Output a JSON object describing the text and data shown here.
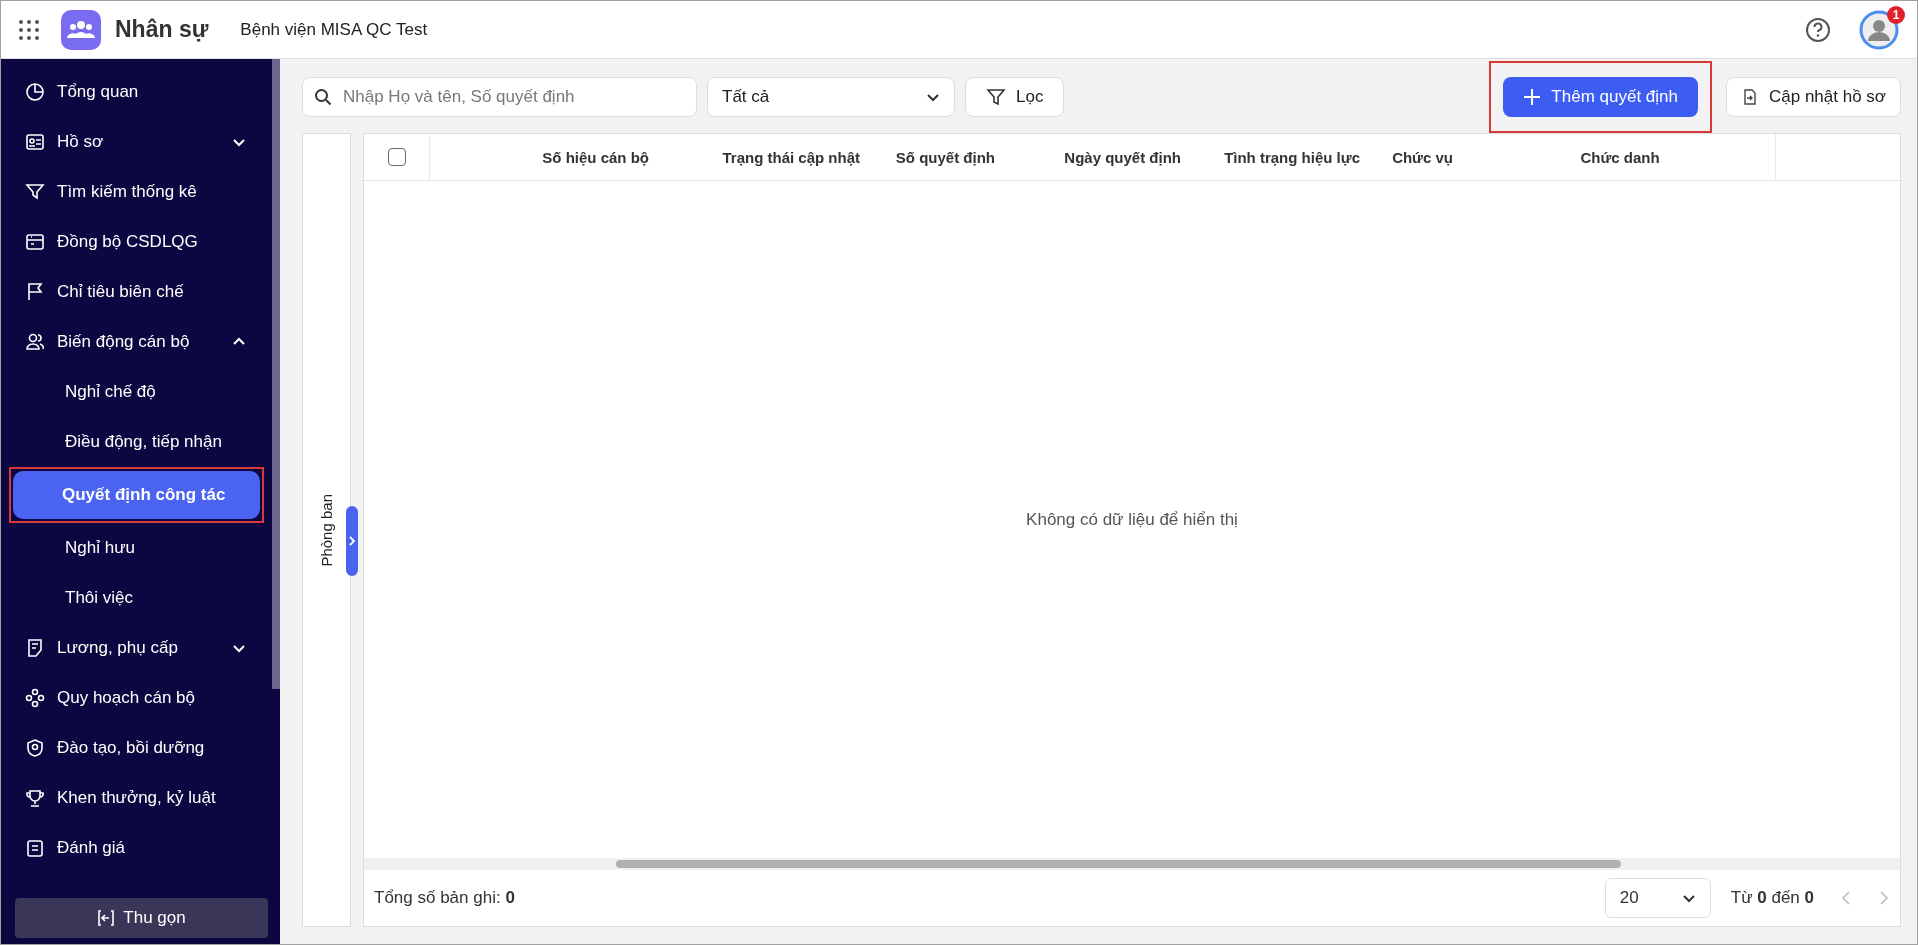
{
  "header": {
    "app_name": "Nhân sự",
    "organization": "Bệnh viện MISA QC Test",
    "notification_count": "1"
  },
  "sidebar": {
    "items": [
      {
        "label": "Tổng quan",
        "kind": "item",
        "selected": false
      },
      {
        "label": "Hồ sơ",
        "kind": "group",
        "expanded": false,
        "selected": false
      },
      {
        "label": "Tìm kiếm thống kê",
        "kind": "item",
        "selected": false
      },
      {
        "label": "Đồng bộ CSDLQG",
        "kind": "item",
        "selected": false
      },
      {
        "label": "Chỉ tiêu biên chế",
        "kind": "item",
        "selected": false
      },
      {
        "label": "Biến động cán bộ",
        "kind": "group",
        "expanded": true,
        "selected": false,
        "children": [
          {
            "label": "Nghỉ chế độ",
            "selected": false
          },
          {
            "label": "Điều động, tiếp nhận",
            "selected": false
          },
          {
            "label": "Quyết định công tác",
            "selected": true
          },
          {
            "label": "Nghỉ hưu",
            "selected": false
          },
          {
            "label": "Thôi việc",
            "selected": false
          }
        ]
      },
      {
        "label": "Lương, phụ cấp",
        "kind": "group",
        "expanded": false,
        "selected": false
      },
      {
        "label": "Quy hoạch cán bộ",
        "kind": "item",
        "selected": false
      },
      {
        "label": "Đào tạo, bồi dưỡng",
        "kind": "item",
        "selected": false
      },
      {
        "label": "Khen thưởng, kỷ luật",
        "kind": "item",
        "selected": false
      },
      {
        "label": "Đánh giá",
        "kind": "item",
        "selected": false
      }
    ],
    "collapse_button": "Thu gọn"
  },
  "toolbar": {
    "search": {
      "placeholder": "Nhập Họ và tên, Số quyết định"
    },
    "status_filter": "Tất cả",
    "filter_button": "Lọc",
    "add_button": "Thêm quyết định",
    "update_button": "Cập nhật hồ sơ"
  },
  "department_panel": {
    "label": "Phòng ban",
    "expanded": false
  },
  "table": {
    "select_all_checked": false,
    "columns": [
      "Số hiệu cán bộ",
      "Trạng thái cập nhật",
      "Số quyết định",
      "Ngày quyết định",
      "Tình trạng hiệu lực",
      "Chức vụ",
      "Chức danh"
    ],
    "empty_message": "Không có dữ liệu để hiển thị"
  },
  "footer": {
    "total": "Tổng số bản ghi: **0**",
    "page_size": "20",
    "range": "Từ **0** đến **0**"
  }
}
